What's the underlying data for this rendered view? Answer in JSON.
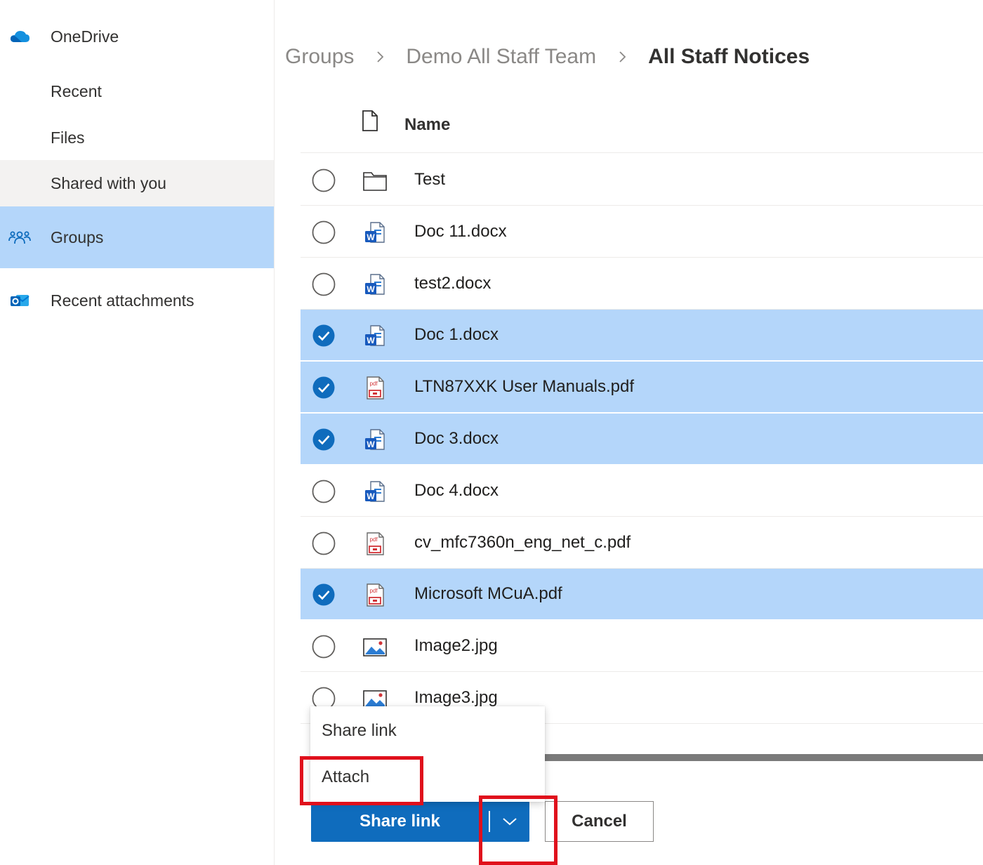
{
  "sidebar": {
    "items": [
      {
        "label": "OneDrive",
        "icon": "onedrive-cloud-icon"
      },
      {
        "label": "Recent"
      },
      {
        "label": "Files"
      },
      {
        "label": "Shared with you"
      },
      {
        "label": "Groups",
        "icon": "groups-icon",
        "selected": true
      },
      {
        "label": "Recent attachments",
        "icon": "outlook-attachments-icon"
      }
    ]
  },
  "breadcrumb": {
    "items": [
      "Groups",
      "Demo All Staff Team",
      "All Staff Notices"
    ]
  },
  "list": {
    "header": {
      "name": "Name"
    },
    "rows": [
      {
        "name": "Test",
        "type": "folder",
        "selected": false
      },
      {
        "name": "Doc 11.docx",
        "type": "word",
        "selected": false
      },
      {
        "name": "test2.docx",
        "type": "word",
        "selected": false
      },
      {
        "name": "Doc 1.docx",
        "type": "word",
        "selected": true
      },
      {
        "name": "LTN87XXK User Manuals.pdf",
        "type": "pdf",
        "selected": true
      },
      {
        "name": "Doc 3.docx",
        "type": "word",
        "selected": true
      },
      {
        "name": "Doc 4.docx",
        "type": "word",
        "selected": false
      },
      {
        "name": "cv_mfc7360n_eng_net_c.pdf",
        "type": "pdf",
        "selected": false
      },
      {
        "name": "Microsoft MCuA.pdf",
        "type": "pdf",
        "selected": true
      },
      {
        "name": "Image2.jpg",
        "type": "image",
        "selected": false
      },
      {
        "name": "Image3.jpg",
        "type": "image",
        "selected": false
      }
    ]
  },
  "menu": {
    "items": [
      "Share link",
      "Attach"
    ]
  },
  "actions": {
    "primary_label": "Share link",
    "cancel_label": "Cancel"
  },
  "colors": {
    "accent": "#0f6cbd",
    "selected_row": "#b4d6fa",
    "highlight_annotation": "#e0101c"
  }
}
